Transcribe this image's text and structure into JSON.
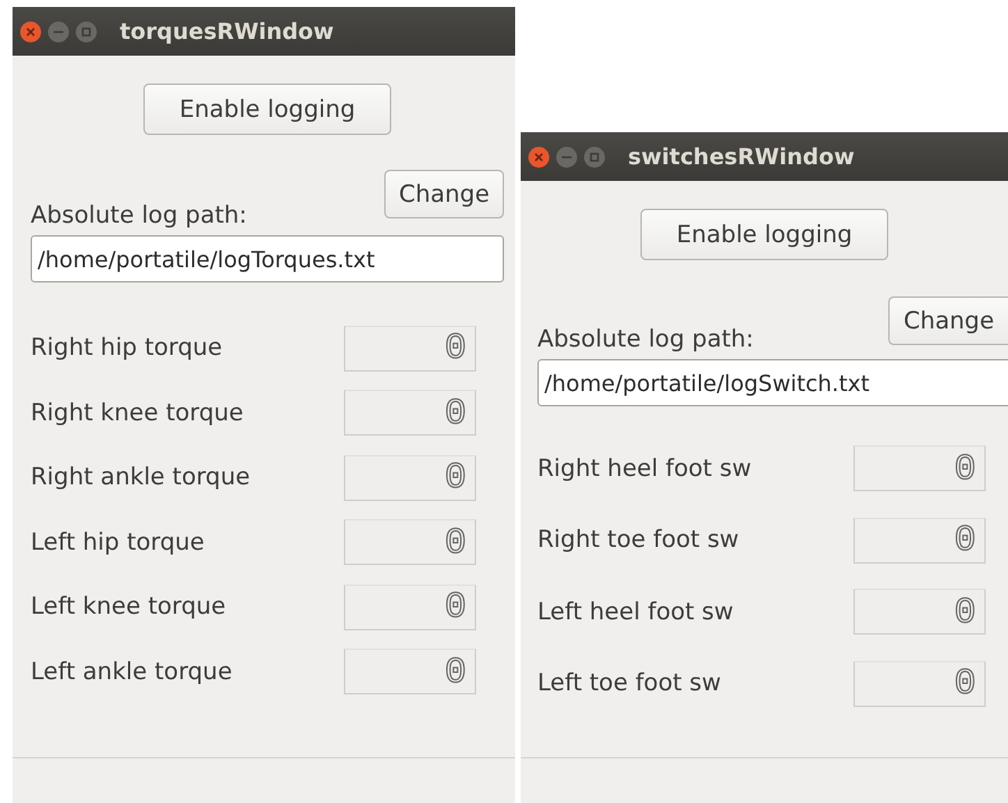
{
  "windows": [
    {
      "title": "torquesRWindow",
      "logging_button": "Enable logging",
      "path_label": "Absolute log path:",
      "change_button": "Change",
      "path": "/home/portatile/logTorques.txt",
      "readings": [
        {
          "label": "Right hip torque",
          "value": "0"
        },
        {
          "label": "Right knee torque",
          "value": "0"
        },
        {
          "label": "Right ankle torque",
          "value": "0"
        },
        {
          "label": "Left hip torque",
          "value": "0"
        },
        {
          "label": "Left knee torque",
          "value": "0"
        },
        {
          "label": "Left ankle torque",
          "value": "0"
        }
      ]
    },
    {
      "title": "switchesRWindow",
      "logging_button": "Enable logging",
      "path_label": "Absolute log path:",
      "change_button": "Change",
      "path": "/home/portatile/logSwitch.txt",
      "readings": [
        {
          "label": "Right heel foot sw",
          "value": "0"
        },
        {
          "label": "Right toe foot sw",
          "value": "0"
        },
        {
          "label": "Left heel foot sw",
          "value": "0"
        },
        {
          "label": "Left toe foot sw",
          "value": "0"
        }
      ]
    }
  ]
}
